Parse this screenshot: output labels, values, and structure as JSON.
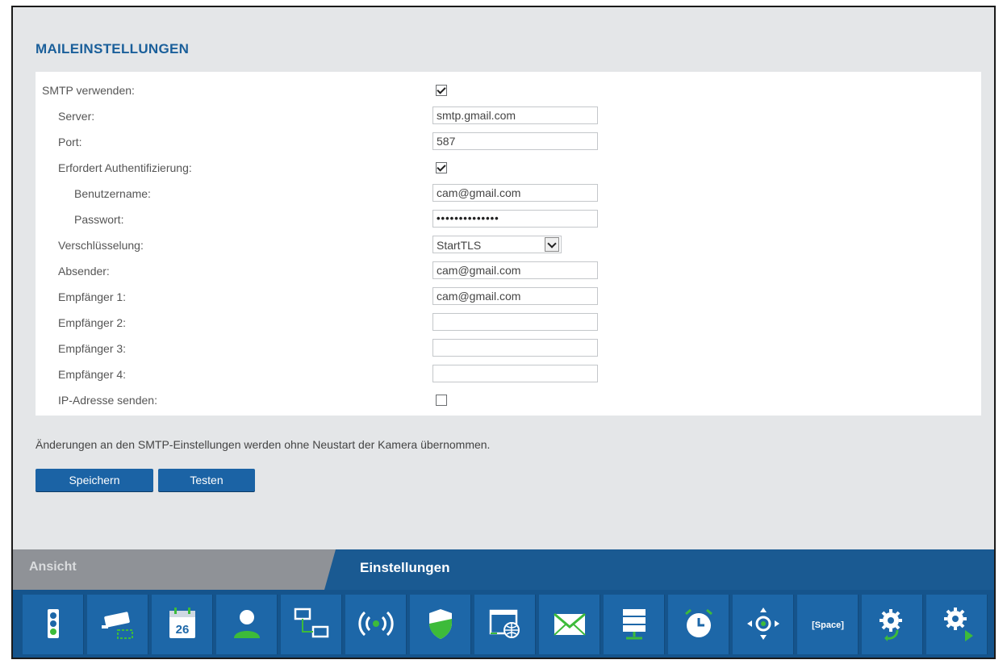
{
  "title": "MAILEINSTELLUNGEN",
  "form": {
    "smtp_label": "SMTP verwenden:",
    "smtp_checked": true,
    "server_label": "Server:",
    "server_value": "smtp.gmail.com",
    "port_label": "Port:",
    "port_value": "587",
    "auth_label": "Erfordert Authentifizierung:",
    "auth_checked": true,
    "user_label": "Benutzername:",
    "user_value": "cam@gmail.com",
    "pass_label": "Passwort:",
    "pass_value": "••••••••••••••",
    "enc_label": "Verschlüsselung:",
    "enc_value": "StartTLS",
    "sender_label": "Absender:",
    "sender_value": "cam@gmail.com",
    "rcpt1_label": "Empfänger 1:",
    "rcpt1_value": "cam@gmail.com",
    "rcpt2_label": "Empfänger 2:",
    "rcpt2_value": "",
    "rcpt3_label": "Empfänger 3:",
    "rcpt3_value": "",
    "rcpt4_label": "Empfänger 4:",
    "rcpt4_value": "",
    "ip_label": "IP-Adresse senden:",
    "ip_checked": false
  },
  "note": "Änderungen an den SMTP-Einstellungen werden ohne Neustart der Kamera übernommen.",
  "buttons": {
    "save": "Speichern",
    "test": "Testen"
  },
  "tabs": {
    "view": "Ansicht",
    "settings": "Einstellungen"
  },
  "toolbar": {
    "calendar_day": "26",
    "space_label": "[Space]",
    "icons": [
      "status-icon",
      "camera-icon",
      "calendar-icon",
      "user-icon",
      "network-icon",
      "wireless-icon",
      "security-icon",
      "web-icon",
      "mail-icon",
      "storage-icon",
      "alarm-clock-icon",
      "ptz-icon",
      "space-icon",
      "maintenance-icon",
      "advanced-settings-icon"
    ]
  },
  "colors": {
    "accent": "#1a5f9a",
    "tab_bar": "#1a5a92",
    "tile": "#1d67a8",
    "green": "#3dbb3a"
  }
}
